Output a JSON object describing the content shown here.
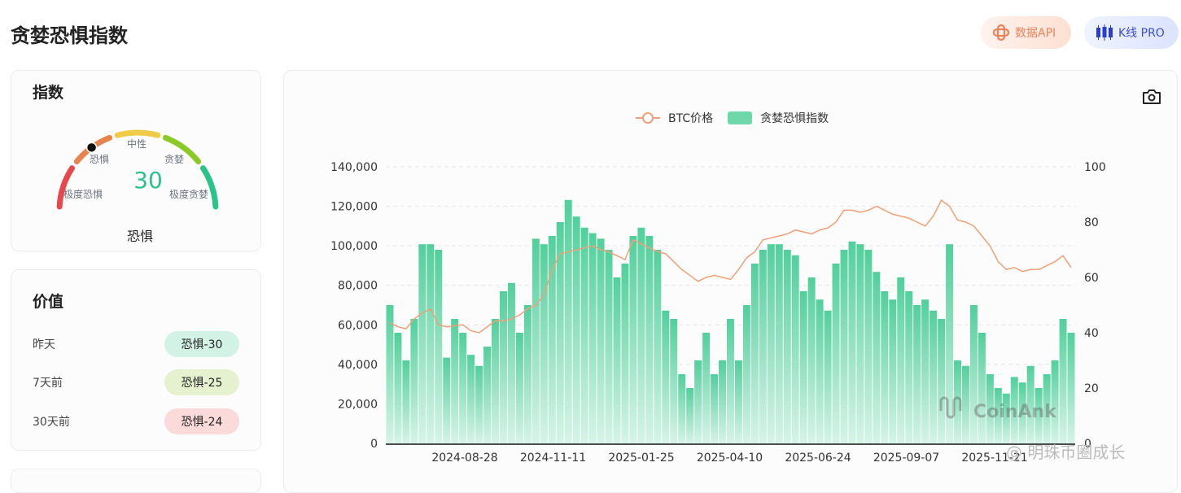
{
  "page_title": "贪婪恐惧指数",
  "header_buttons": {
    "api": "数据API",
    "kline": "K线 PRO"
  },
  "index_card": {
    "title": "指数",
    "value": "30",
    "state": "恐惧",
    "zones": [
      "极度恐惧",
      "恐惧",
      "中性",
      "贪婪",
      "极度贪婪"
    ],
    "gauge_value": 30,
    "zone_colors": [
      "#e5484d",
      "#e8834e",
      "#efcb48",
      "#8ac926",
      "#2ac48a"
    ]
  },
  "value_card": {
    "title": "价值",
    "rows": [
      {
        "label": "昨天",
        "value": "恐惧-30",
        "bg": "#d3f2e6"
      },
      {
        "label": "7天前",
        "value": "恐惧-25",
        "bg": "#e6f2cf"
      },
      {
        "label": "30天前",
        "value": "恐惧-24",
        "bg": "#fbdada"
      }
    ]
  },
  "watermark": "@ 明珠币圈成长",
  "chart_data": {
    "type": "bar+line",
    "legend": [
      "BTC价格",
      "贪婪恐惧指数"
    ],
    "legend_placement": "top-center",
    "start_date": "2024-06-22",
    "interval_days": 7,
    "x_ticks": [
      "2024-08-28",
      "2024-11-11",
      "2025-01-25",
      "2025-04-10",
      "2025-06-24",
      "2025-09-07",
      "2025-11-21"
    ],
    "y_left": {
      "ticks": [
        "0",
        "20,000",
        "40,000",
        "60,000",
        "80,000",
        "100,000",
        "120,000",
        "140,000"
      ],
      "range": [
        0,
        140000
      ]
    },
    "y_right": {
      "ticks": [
        "0",
        "20",
        "40",
        "60",
        "80",
        "100"
      ],
      "range": [
        0,
        100
      ]
    },
    "fear_greed": [
      50,
      40,
      30,
      45,
      72,
      72,
      70,
      31,
      45,
      40,
      32,
      28,
      35,
      45,
      55,
      58,
      40,
      50,
      74,
      72,
      75,
      80,
      88,
      82,
      78,
      76,
      74,
      70,
      60,
      65,
      75,
      78,
      75,
      70,
      48,
      45,
      25,
      20,
      30,
      40,
      25,
      30,
      45,
      30,
      50,
      65,
      70,
      72,
      72,
      70,
      68,
      55,
      60,
      52,
      48,
      65,
      70,
      73,
      72,
      70,
      62,
      55,
      52,
      60,
      55,
      50,
      52,
      48,
      45,
      72,
      30,
      28,
      50,
      40,
      25,
      20,
      18,
      24,
      22,
      28,
      20,
      25,
      30,
      45,
      40
    ],
    "btc_price": [
      61000,
      59000,
      58000,
      63000,
      66000,
      68000,
      60000,
      59000,
      59500,
      60000,
      57000,
      56000,
      59000,
      62000,
      62000,
      63000,
      65000,
      68000,
      70000,
      75000,
      88000,
      96000,
      97000,
      98000,
      99000,
      100000,
      98000,
      97000,
      95000,
      93000,
      103000,
      101000,
      99000,
      97000,
      96000,
      92000,
      88000,
      85000,
      82000,
      84000,
      85000,
      84000,
      83000,
      88000,
      94000,
      97000,
      103000,
      104000,
      105000,
      106000,
      108000,
      107000,
      106000,
      108000,
      109000,
      112000,
      118000,
      118000,
      117000,
      118000,
      120000,
      118000,
      116000,
      115000,
      114000,
      112000,
      110000,
      115000,
      123000,
      120000,
      113000,
      112000,
      110000,
      105000,
      100000,
      92000,
      88000,
      89000,
      87000,
      88000,
      88000,
      90000,
      92000,
      95000,
      89000
    ],
    "bar_color": "#5fd3a3",
    "line_color": "#f0a078",
    "logo_text": "CoinAnk"
  }
}
